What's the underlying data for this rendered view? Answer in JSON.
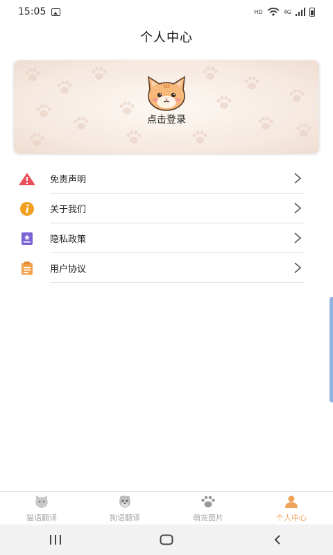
{
  "status_bar": {
    "time": "15:05",
    "hd": "HD",
    "network": "4G"
  },
  "header": {
    "title": "个人中心"
  },
  "banner": {
    "login_label": "点击登录"
  },
  "menu": {
    "items": [
      {
        "label": "免责声明",
        "icon": "warning-icon"
      },
      {
        "label": "关于我们",
        "icon": "info-icon"
      },
      {
        "label": "隐私政策",
        "icon": "privacy-icon"
      },
      {
        "label": "用户协议",
        "icon": "agreement-icon"
      }
    ]
  },
  "tabbar": {
    "tabs": [
      {
        "label": "猫语翻译",
        "icon": "cat-icon",
        "active": false
      },
      {
        "label": "狗语翻译",
        "icon": "dog-icon",
        "active": false
      },
      {
        "label": "萌宠图片",
        "icon": "paw-icon",
        "active": false
      },
      {
        "label": "个人中心",
        "icon": "person-icon",
        "active": true
      }
    ]
  },
  "colors": {
    "accent": "#f0a25a",
    "warning": "#e8505b",
    "info": "#f0a020",
    "privacy": "#7b63d6",
    "agreement": "#f2a24a",
    "inactive_tab": "#aaaaaa"
  }
}
